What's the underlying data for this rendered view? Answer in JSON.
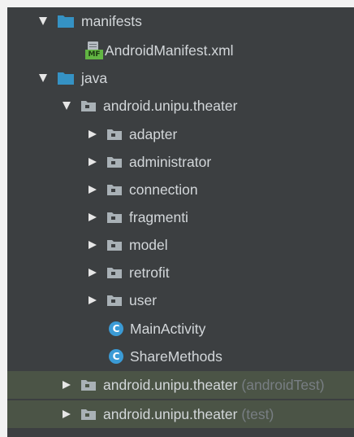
{
  "tree": {
    "manifests": "manifests",
    "manifest_file": "AndroidManifest.xml",
    "manifest_badge": "MF",
    "java": "java",
    "package_main": "android.unipu.theater",
    "subfolders": [
      "adapter",
      "administrator",
      "connection",
      "fragmenti",
      "model",
      "retrofit",
      "user"
    ],
    "class_icon_letter": "C",
    "classes": [
      "MainActivity",
      "ShareMethods"
    ],
    "package_android_test": "android.unipu.theater",
    "android_test_suffix": "(androidTest)",
    "package_test": "android.unipu.theater",
    "test_suffix": "(test)"
  },
  "colors": {
    "panel_bg": "#3c3f41",
    "text": "#d3d7da",
    "muted_text": "#787e83",
    "folder_blue": "#3592c4",
    "package_folder": "#a9b1b6",
    "class_icon": "#3b9bd6",
    "highlight_row": "#4b5446"
  }
}
